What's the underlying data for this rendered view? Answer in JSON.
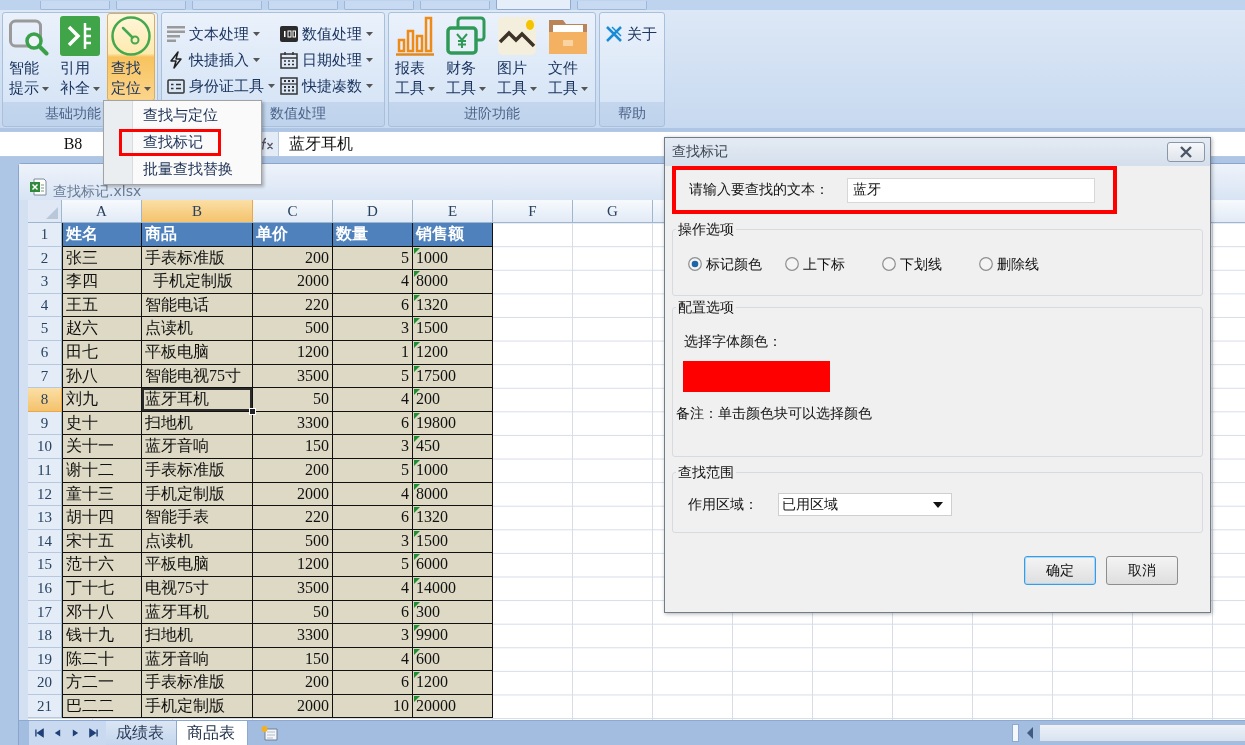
{
  "ribbon_tabs": [
    {
      "selected": false
    },
    {
      "selected": false
    },
    {
      "selected": false
    },
    {
      "selected": false
    },
    {
      "selected": false
    },
    {
      "selected": false
    },
    {
      "selected": true
    },
    {
      "selected": false
    }
  ],
  "ribbon": {
    "groups": [
      {
        "label": "基础功能",
        "kind": "large",
        "items": [
          {
            "label": "智能提示",
            "dropdown": true,
            "active": false
          },
          {
            "label": "引用补全",
            "dropdown": true,
            "active": false
          },
          {
            "label": "查找定位",
            "dropdown": true,
            "active": true
          }
        ]
      },
      {
        "label": "数值处理",
        "kind": "small",
        "items": [
          {
            "label": "文本处理",
            "dropdown": true,
            "active": false
          },
          {
            "label": "数值处理",
            "dropdown": true,
            "active": false
          },
          {
            "label": "快捷插入",
            "dropdown": true,
            "active": false
          },
          {
            "label": "日期处理",
            "dropdown": true,
            "active": false
          },
          {
            "label": "身份证工具",
            "dropdown": true,
            "active": false
          },
          {
            "label": "快捷凑数",
            "dropdown": true,
            "active": false
          }
        ]
      },
      {
        "label": "进阶功能",
        "kind": "large",
        "items": [
          {
            "label": "报表工具",
            "dropdown": true,
            "active": false
          },
          {
            "label": "财务工具",
            "dropdown": true,
            "active": false
          },
          {
            "label": "图片工具",
            "dropdown": true,
            "active": false
          },
          {
            "label": "文件工具",
            "dropdown": true,
            "active": false
          }
        ]
      },
      {
        "label": "帮助",
        "kind": "small",
        "items": [
          {
            "label": "关于",
            "dropdown": false,
            "active": false
          }
        ]
      }
    ]
  },
  "dropdown_menu": {
    "items": [
      {
        "label": "查找与定位",
        "annotated": false
      },
      {
        "label": "查找标记",
        "annotated": true
      },
      {
        "label": "批量查找替换",
        "annotated": false
      }
    ]
  },
  "formula_bar": {
    "name_box": "B8",
    "formula": "蓝牙耳机"
  },
  "workbook": {
    "title": "查找标记.xlsx",
    "columns": [
      {
        "label": "A",
        "selected": false
      },
      {
        "label": "B",
        "selected": true
      },
      {
        "label": "C",
        "selected": false
      },
      {
        "label": "D",
        "selected": false
      },
      {
        "label": "E",
        "selected": false
      },
      {
        "label": "F",
        "selected": false
      },
      {
        "label": "G",
        "selected": false
      }
    ],
    "rows": [
      {
        "number": "1",
        "kind": "header",
        "selected": false,
        "flagged": false,
        "cells": [
          "姓名",
          "商品",
          "单价",
          "数量",
          "销售额"
        ]
      },
      {
        "number": "2",
        "kind": "data",
        "selected": false,
        "flagged": true,
        "cells": [
          "张三",
          "手表标准版",
          "200",
          "5",
          "1000"
        ]
      },
      {
        "number": "3",
        "kind": "data",
        "selected": false,
        "flagged": true,
        "cells": [
          "李四",
          "  手机定制版",
          "2000",
          "4",
          "8000"
        ]
      },
      {
        "number": "4",
        "kind": "data",
        "selected": false,
        "flagged": true,
        "cells": [
          "王五",
          "智能电话",
          "220",
          "6",
          "1320"
        ]
      },
      {
        "number": "5",
        "kind": "data",
        "selected": false,
        "flagged": true,
        "cells": [
          "赵六",
          "点读机",
          "500",
          "3",
          "1500"
        ]
      },
      {
        "number": "6",
        "kind": "data",
        "selected": false,
        "flagged": true,
        "cells": [
          "田七",
          "平板电脑",
          "1200",
          "1",
          "1200"
        ]
      },
      {
        "number": "7",
        "kind": "data",
        "selected": false,
        "flagged": true,
        "cells": [
          "孙八",
          "智能电视75寸",
          "3500",
          "5",
          "17500"
        ]
      },
      {
        "number": "8",
        "kind": "data",
        "selected": true,
        "flagged": true,
        "cells": [
          "刘九",
          "蓝牙耳机",
          "50",
          "4",
          "200"
        ]
      },
      {
        "number": "9",
        "kind": "data",
        "selected": false,
        "flagged": true,
        "cells": [
          "史十",
          "扫地机",
          "3300",
          "6",
          "19800"
        ]
      },
      {
        "number": "10",
        "kind": "data",
        "selected": false,
        "flagged": true,
        "cells": [
          "关十一",
          "蓝牙音响",
          "150",
          "3",
          "450"
        ]
      },
      {
        "number": "11",
        "kind": "data",
        "selected": false,
        "flagged": true,
        "cells": [
          "谢十二",
          "手表标准版",
          "200",
          "5",
          "1000"
        ]
      },
      {
        "number": "12",
        "kind": "data",
        "selected": false,
        "flagged": true,
        "cells": [
          "童十三",
          "手机定制版",
          "2000",
          "4",
          "8000"
        ]
      },
      {
        "number": "13",
        "kind": "data",
        "selected": false,
        "flagged": true,
        "cells": [
          "胡十四",
          "智能手表",
          "220",
          "6",
          "1320"
        ]
      },
      {
        "number": "14",
        "kind": "data",
        "selected": false,
        "flagged": true,
        "cells": [
          "宋十五",
          "点读机",
          "500",
          "3",
          "1500"
        ]
      },
      {
        "number": "15",
        "kind": "data",
        "selected": false,
        "flagged": true,
        "cells": [
          "范十六",
          "平板电脑",
          "1200",
          "5",
          "6000"
        ]
      },
      {
        "number": "16",
        "kind": "data",
        "selected": false,
        "flagged": true,
        "cells": [
          "丁十七",
          "电视75寸",
          "3500",
          "4",
          "14000"
        ]
      },
      {
        "number": "17",
        "kind": "data",
        "selected": false,
        "flagged": true,
        "cells": [
          "邓十八",
          "蓝牙耳机",
          "50",
          "6",
          "300"
        ]
      },
      {
        "number": "18",
        "kind": "data",
        "selected": false,
        "flagged": true,
        "cells": [
          "钱十九",
          "扫地机",
          "3300",
          "3",
          "9900"
        ]
      },
      {
        "number": "19",
        "kind": "data",
        "selected": false,
        "flagged": true,
        "cells": [
          "陈二十",
          "蓝牙音响",
          "150",
          "4",
          "600"
        ]
      },
      {
        "number": "20",
        "kind": "data",
        "selected": false,
        "flagged": true,
        "cells": [
          "方二一",
          "手表标准版",
          "200",
          "6",
          "1200"
        ]
      },
      {
        "number": "21",
        "kind": "data",
        "selected": false,
        "flagged": true,
        "cells": [
          "巴二二",
          "手机定制版",
          "2000",
          "10",
          "20000"
        ]
      }
    ]
  },
  "sheet_tabs": [
    {
      "label": "成绩表",
      "selected": false
    },
    {
      "label": "商品表",
      "selected": true
    }
  ],
  "dialog": {
    "title": "查找标记",
    "search": {
      "label": "请输入要查找的文本：",
      "value": "蓝牙",
      "annotated": true
    },
    "operation_group": {
      "title": "操作选项",
      "options": [
        {
          "label": "标记颜色",
          "selected": true
        },
        {
          "label": "上下标",
          "selected": false
        },
        {
          "label": "下划线",
          "selected": false
        },
        {
          "label": "删除线",
          "selected": false
        }
      ]
    },
    "config_group": {
      "title": "配置选项",
      "color_label": "选择字体颜色：",
      "color": "#ff0000",
      "note": "备注：单击颜色块可以选择颜色"
    },
    "scope_group": {
      "title": "查找范围",
      "label": "作用区域：",
      "value": "已用区域"
    },
    "buttons": [
      {
        "label": "确定",
        "kind": "default"
      },
      {
        "label": "取消",
        "kind": "normal"
      }
    ]
  }
}
